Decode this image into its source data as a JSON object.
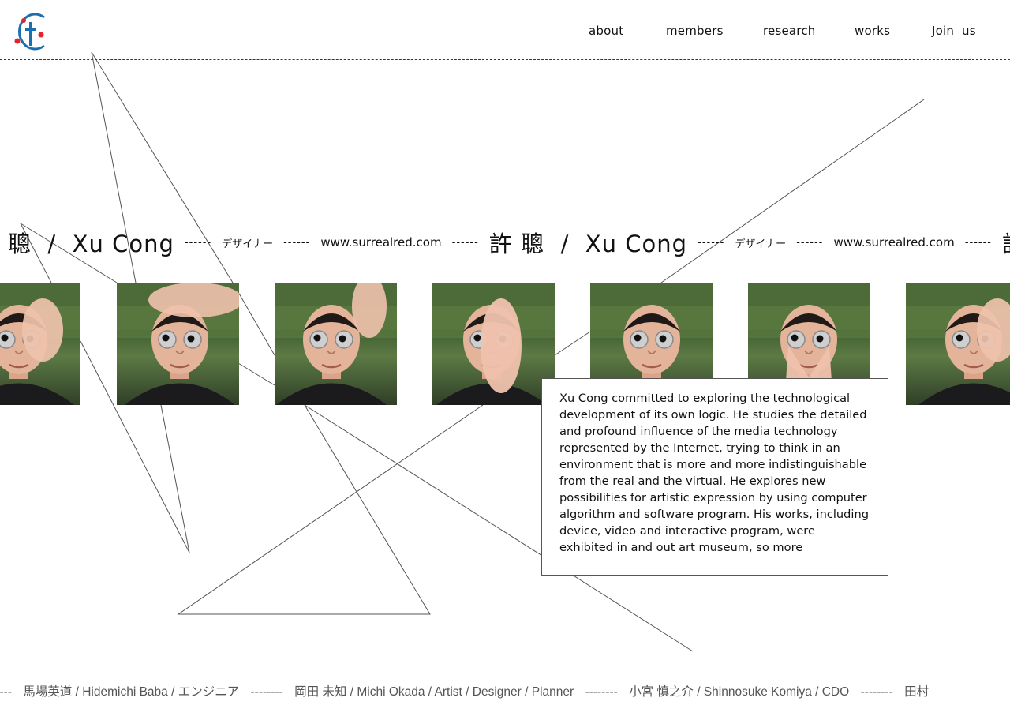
{
  "brand": {
    "primary_color": "#1a6fb3",
    "accent_color": "#e8222b"
  },
  "nav": {
    "items": [
      {
        "label": "about"
      },
      {
        "label": "members"
      },
      {
        "label": "research"
      },
      {
        "label": "works"
      },
      {
        "label": "Join  us"
      }
    ]
  },
  "profile": {
    "name": "許 聰  /  Xu Cong",
    "name_cut_left": "聰  /  Xu Cong",
    "name_cut_right": "許 聰",
    "separator": "------",
    "role": "デザイナー",
    "url": "www.surrealred.com",
    "bio": "Xu Cong committed to exploring the technological development of its own logic. He studies the detailed and profound influence of the media technology represented by the Internet, trying to think in an environment that is more and more indistinguishable from the real and the virtual. He explores new possibilities for artistic expression by using computer algorithm and software program. His works, including device, video and interactive program, were exhibited in and out art museum, so more",
    "photo_count": 7
  },
  "members_ticker": {
    "separator_left": "------",
    "separator": "--------",
    "entries": [
      "馬場英道 / Hidemichi Baba / エンジニア",
      "岡田 未知 / Michi Okada / Artist / Designer / Planner",
      "小宮 慎之介 / Shinnosuke Komiya / CDO",
      "田村"
    ]
  }
}
